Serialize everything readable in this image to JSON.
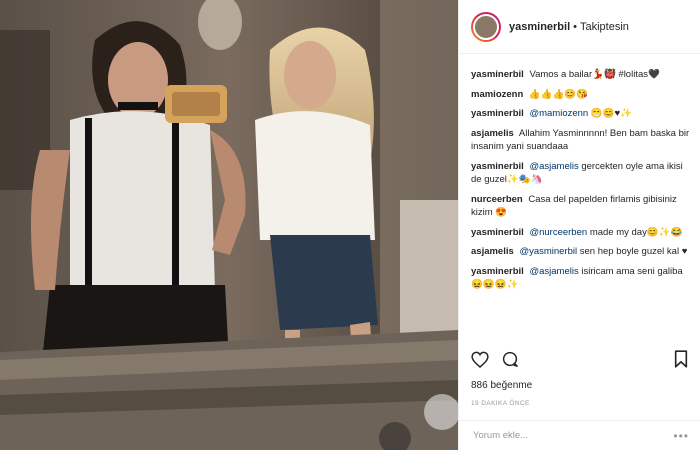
{
  "header": {
    "username": "yasminerbil",
    "separator": "•",
    "follow_status": "Takiptesin"
  },
  "comments": [
    {
      "user": "yasminerbil",
      "mention": "",
      "text": "Vamos a bailar💃👹 #lolitas🖤"
    },
    {
      "user": "mamiozenn",
      "mention": "",
      "text": "👍👍👍😊😘"
    },
    {
      "user": "yasminerbil",
      "mention": "@mamiozenn",
      "text": "😁😊♥✨"
    },
    {
      "user": "asjamelis",
      "mention": "",
      "text": "Allahim Yasminnnnn! Ben bam baska bir insanim yani suandaaa"
    },
    {
      "user": "yasminerbil",
      "mention": "@asjamelis",
      "text": "gercekten oyle ama ikisi de guzel✨🎭🦄"
    },
    {
      "user": "nurceerben",
      "mention": "",
      "text": "Casa del papelden firlamis gibisiniz kizim 😍"
    },
    {
      "user": "yasminerbil",
      "mention": "@nurceerben",
      "text": "made my day😊✨😂"
    },
    {
      "user": "asjamelis",
      "mention": "@yasminerbil",
      "text": "sen hep boyle guzel kal ♥"
    },
    {
      "user": "yasminerbil",
      "mention": "@asjamelis",
      "text": "isiricam ama seni galiba😖😖😖✨"
    }
  ],
  "likes_text": "886 beğenme",
  "time_text": "19 DAKIKA ÖNCE",
  "add_comment_placeholder": "Yorum ekle...",
  "more_options": "•••",
  "icons": {
    "like": "heart-icon",
    "comment": "comment-icon",
    "save": "bookmark-icon",
    "more": "more-options-icon"
  },
  "colors": {
    "mention": "#003569",
    "muted": "#999999",
    "text": "#262626",
    "avatar_ring": "#dc2743"
  }
}
